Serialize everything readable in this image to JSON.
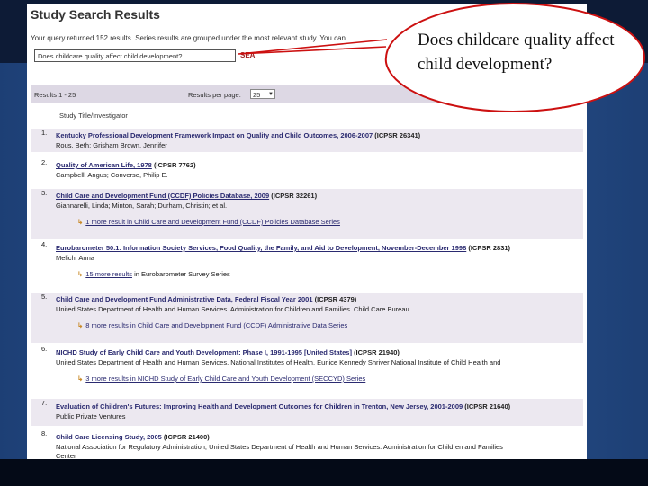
{
  "header": {
    "title": "Study Search Results",
    "query_text": "Your query returned 152 results. Series results are grouped under the most relevant study. You can",
    "search_value": "Does childcare quality affect child development?",
    "search_button": "SEA"
  },
  "results_bar": {
    "range": "Results 1 - 25",
    "per_page_label": "Results per page:",
    "per_page_value": "25"
  },
  "column_header": "Study Title/Investigator",
  "results": [
    {
      "num": "1.",
      "title": "Kentucky Professional Development Framework Impact on Quality and Child Outcomes, 2006-2007",
      "id": "(ICPSR 26341)",
      "authors": "Rous, Beth; Grisham Brown, Jennifer",
      "more": null,
      "shaded": true
    },
    {
      "num": "2.",
      "title": "Quality of American Life, 1978",
      "id": "(ICPSR 7762)",
      "authors": "Campbell, Angus; Converse, Philip E.",
      "more": null,
      "shaded": false
    },
    {
      "num": "3.",
      "title": "Child Care and Development Fund (CCDF) Policies Database, 2009",
      "id": "(ICPSR 32261)",
      "authors": "Giannarelli, Linda; Minton, Sarah; Durham, Christin; et al.",
      "more": {
        "link": "1 more result",
        "rest": " in Child Care and Development Fund (CCDF) Policies Database Series"
      },
      "shaded": true
    },
    {
      "num": "4.",
      "title": "Eurobarometer 50.1: Information Society Services, Food Quality, the Family, and Aid to Development, November-December 1998",
      "id": "(ICPSR 2831)",
      "authors": "Melich, Anna",
      "more": {
        "link": "15 more results",
        "rest": " in Eurobarometer Survey Series"
      },
      "shaded": false
    },
    {
      "num": "5.",
      "title": "Child Care and Development Fund Administrative Data, Federal Fiscal Year 2001",
      "id": "(ICPSR 4379)",
      "authors": "United States Department of Health and Human Services. Administration for Children and Families. Child Care Bureau",
      "more": {
        "link": "8 more results",
        "rest": " in Child Care and Development Fund (CCDF) Administrative Data Series"
      },
      "shaded": true
    },
    {
      "num": "6.",
      "title": "NICHD Study of Early Child Care and Youth Development: Phase I, 1991-1995 [United States]",
      "id": "(ICPSR 21940)",
      "authors": "United States Department of Health and Human Services. National Institutes of Health. Eunice Kennedy Shriver National Institute of Child Health and",
      "more": {
        "link": "3 more results",
        "rest": " in NICHD Study of Early Child Care and Youth Development (SECCYD) Series"
      },
      "shaded": false
    },
    {
      "num": "7.",
      "title": "Evaluation of Children's Futures: Improving Health and Development Outcomes for Children in Trenton, New Jersey, 2001-2009",
      "id": "(ICPSR 21640)",
      "authors": "Public Private Ventures",
      "more": null,
      "shaded": true
    },
    {
      "num": "8.",
      "title": "Child Care Licensing Study, 2005",
      "id": "(ICPSR 21400)",
      "authors": "National Association for Regulatory Administration; United States Department of Health and Human Services. Administration for Children and Families",
      "authors2": "Center",
      "more": null,
      "shaded": false
    }
  ],
  "callout": {
    "text": "Does childcare quality affect child development?",
    "stroke_color": "#cc1010"
  }
}
